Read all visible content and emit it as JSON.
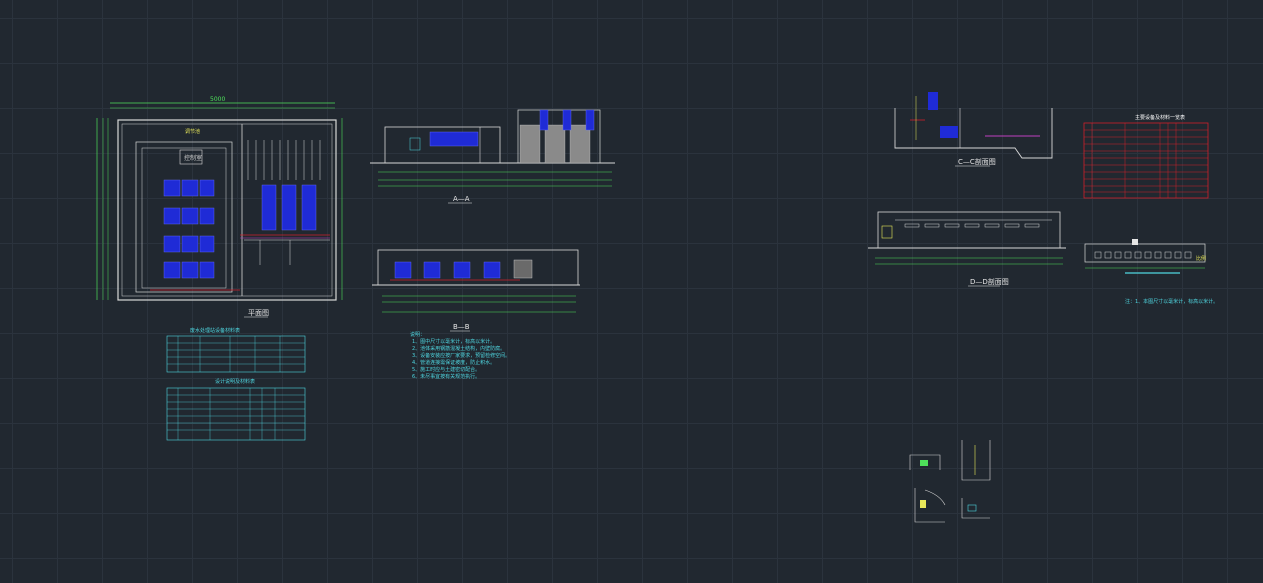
{
  "colors": {
    "background": "#212830",
    "grid": "#2b333d",
    "outline": "#d8d8d8",
    "dimension": "#4ee05a",
    "equipment": "#1f2bd6",
    "text_cyan": "#4fd6e0",
    "table_red": "#d0202a",
    "magenta": "#c040c0",
    "yellow": "#e8e85a"
  },
  "drawing": {
    "plan_view": {
      "title": "平面图",
      "overall_width": "5000",
      "overall_height": "5000",
      "label_room": "控制室",
      "label_pool": "调节池"
    },
    "section_aa": {
      "title": "A—A"
    },
    "section_bb": {
      "title": "B—B"
    },
    "section_cc": {
      "title": "C—C剖面图"
    },
    "section_dd": {
      "title": "D—D剖面图"
    },
    "table_equipment": {
      "title": "主要设备及材料一览表"
    },
    "table_equipment_left": {
      "title": "废水处理站设备材料表"
    },
    "table_equipment_left2": {
      "title": "设计说明及材料表"
    },
    "notes_title": "说明：",
    "notes_lines": [
      "1、图中尺寸以毫米计，标高以米计。",
      "2、池体采用钢筋混凝土结构，内壁防腐。",
      "3、设备安装应按厂家要求，预留检修空间。",
      "4、管道连接需保证坡度，防止积水。",
      "5、施工时应与土建密切配合。",
      "6、未尽事宜按有关规范执行。"
    ],
    "right_note": "注：1、本图尺寸以毫米计，标高以米计。",
    "scale_label": "比例"
  }
}
